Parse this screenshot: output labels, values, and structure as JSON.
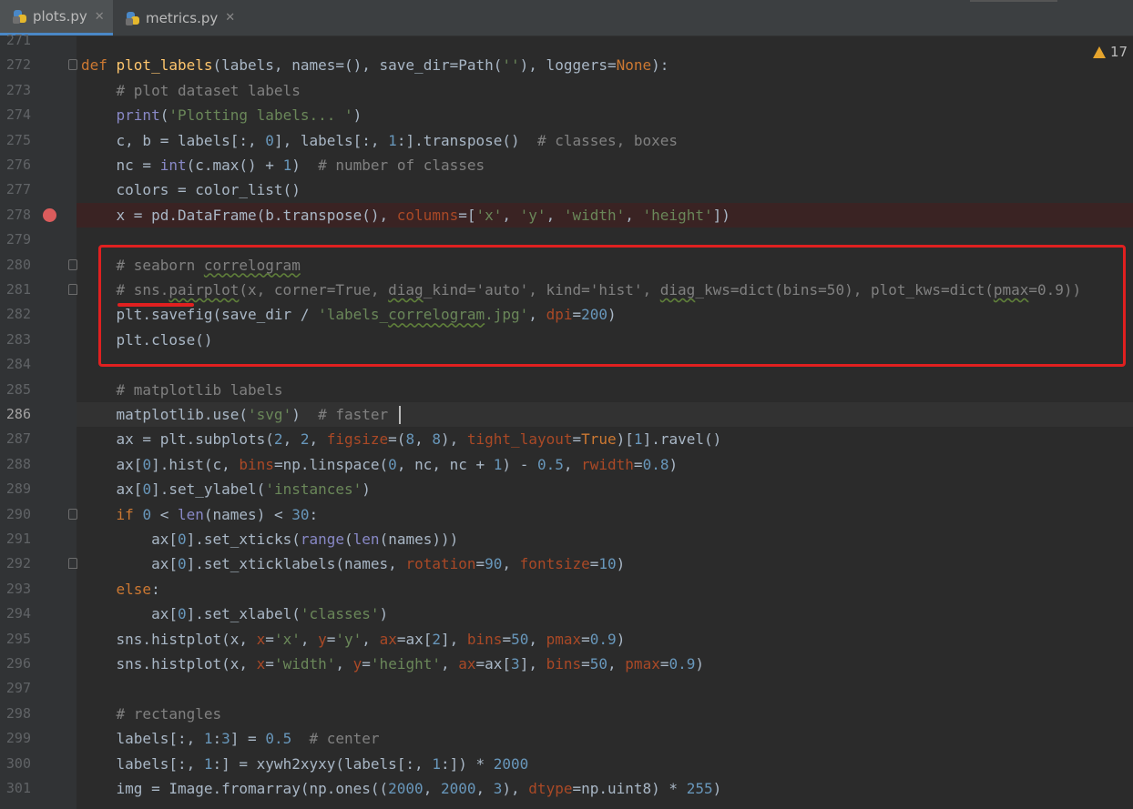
{
  "tabs": [
    {
      "label": "plots.py",
      "active": true
    },
    {
      "label": "metrics.py",
      "active": false
    }
  ],
  "warnings": {
    "count": "17"
  },
  "lines": [
    {
      "n": "271"
    },
    {
      "n": "272"
    },
    {
      "n": "273"
    },
    {
      "n": "274"
    },
    {
      "n": "275"
    },
    {
      "n": "276"
    },
    {
      "n": "277"
    },
    {
      "n": "278"
    },
    {
      "n": "279"
    },
    {
      "n": "280"
    },
    {
      "n": "281"
    },
    {
      "n": "282"
    },
    {
      "n": "283"
    },
    {
      "n": "284"
    },
    {
      "n": "285"
    },
    {
      "n": "286"
    },
    {
      "n": "287"
    },
    {
      "n": "288"
    },
    {
      "n": "289"
    },
    {
      "n": "290"
    },
    {
      "n": "291"
    },
    {
      "n": "292"
    },
    {
      "n": "293"
    },
    {
      "n": "294"
    },
    {
      "n": "295"
    },
    {
      "n": "296"
    },
    {
      "n": "297"
    },
    {
      "n": "298"
    },
    {
      "n": "299"
    },
    {
      "n": "300"
    },
    {
      "n": "301"
    }
  ],
  "code": {
    "l272": [
      [
        "kw",
        "def "
      ],
      [
        "fn",
        "plot_labels"
      ],
      [
        "",
        "(labels, names=(), save_dir=Path("
      ],
      [
        "str",
        "''"
      ],
      [
        "",
        "), loggers="
      ],
      [
        "kw",
        "None"
      ],
      [
        "",
        "):"
      ]
    ],
    "l273": [
      [
        "",
        "    "
      ],
      [
        "cmt",
        "# plot dataset labels"
      ]
    ],
    "l274": [
      [
        "",
        "    "
      ],
      [
        "bi",
        "print"
      ],
      [
        "",
        "("
      ],
      [
        "str",
        "'Plotting labels... '"
      ],
      [
        "",
        ")"
      ]
    ],
    "l275": [
      [
        "",
        "    c, b = labels[:, "
      ],
      [
        "num",
        "0"
      ],
      [
        "",
        "], labels[:, "
      ],
      [
        "num",
        "1"
      ],
      [
        "",
        ":].transpose()  "
      ],
      [
        "cmt",
        "# classes, boxes"
      ]
    ],
    "l276": [
      [
        "",
        "    nc = "
      ],
      [
        "bi",
        "int"
      ],
      [
        "",
        "(c.max() + "
      ],
      [
        "num",
        "1"
      ],
      [
        "",
        ")  "
      ],
      [
        "cmt",
        "# number of classes"
      ]
    ],
    "l277": [
      [
        "",
        "    colors = color_list()"
      ]
    ],
    "l278": [
      [
        "",
        "    x = pd.DataFrame(b.transpose(), "
      ],
      [
        "param",
        "columns"
      ],
      [
        "",
        "=["
      ],
      [
        "str",
        "'x'"
      ],
      [
        "",
        ", "
      ],
      [
        "str",
        "'y'"
      ],
      [
        "",
        ", "
      ],
      [
        "str",
        "'width'"
      ],
      [
        "",
        ", "
      ],
      [
        "str",
        "'height'"
      ],
      [
        "",
        "])"
      ]
    ],
    "l279": [],
    "l280": [
      [
        "",
        "    "
      ],
      [
        "cmt",
        "# seaborn "
      ],
      [
        "cmt squig",
        "correlogram"
      ]
    ],
    "l281": [
      [
        "",
        "    "
      ],
      [
        "cmt",
        "# sns."
      ],
      [
        "cmt squig",
        "pairplot"
      ],
      [
        "cmt",
        "(x, corner=True, "
      ],
      [
        "cmt squig",
        "diag"
      ],
      [
        "cmt",
        "_kind='auto', kind='hist', "
      ],
      [
        "cmt squig",
        "diag"
      ],
      [
        "cmt",
        "_kws=dict(bins=50), plot_kws=dict("
      ],
      [
        "cmt squig",
        "pmax"
      ],
      [
        "cmt",
        "=0.9))"
      ]
    ],
    "l282": [
      [
        "",
        "    plt.savefig(save_dir / "
      ],
      [
        "str",
        "'labels_"
      ],
      [
        "str squig",
        "correlogram"
      ],
      [
        "str",
        ".jpg'"
      ],
      [
        "",
        ", "
      ],
      [
        "param",
        "dpi"
      ],
      [
        "",
        "="
      ],
      [
        "num",
        "200"
      ],
      [
        "",
        ")"
      ]
    ],
    "l283": [
      [
        "",
        "    plt.close()"
      ]
    ],
    "l284": [],
    "l285": [
      [
        "",
        "    "
      ],
      [
        "cmt",
        "# matplotlib labels"
      ]
    ],
    "l286": [
      [
        "",
        "    matplotlib.use("
      ],
      [
        "str",
        "'svg'"
      ],
      [
        "",
        ")  "
      ],
      [
        "cmt",
        "# faster"
      ]
    ],
    "l287": [
      [
        "",
        "    ax = plt.subplots("
      ],
      [
        "num",
        "2"
      ],
      [
        "",
        ", "
      ],
      [
        "num",
        "2"
      ],
      [
        "",
        ", "
      ],
      [
        "param",
        "figsize"
      ],
      [
        "",
        "=("
      ],
      [
        "num",
        "8"
      ],
      [
        "",
        ", "
      ],
      [
        "num",
        "8"
      ],
      [
        "",
        "), "
      ],
      [
        "param",
        "tight_layout"
      ],
      [
        "",
        "="
      ],
      [
        "kw",
        "True"
      ],
      [
        "",
        ")["
      ],
      [
        "num",
        "1"
      ],
      [
        "",
        "].ravel()"
      ]
    ],
    "l288": [
      [
        "",
        "    ax["
      ],
      [
        "num",
        "0"
      ],
      [
        "",
        "].hist(c, "
      ],
      [
        "param",
        "bins"
      ],
      [
        "",
        "=np.linspace("
      ],
      [
        "num",
        "0"
      ],
      [
        "",
        ", nc, nc + "
      ],
      [
        "num",
        "1"
      ],
      [
        "",
        ") - "
      ],
      [
        "num",
        "0.5"
      ],
      [
        "",
        ", "
      ],
      [
        "param",
        "rwidth"
      ],
      [
        "",
        "="
      ],
      [
        "num",
        "0.8"
      ],
      [
        "",
        ")"
      ]
    ],
    "l289": [
      [
        "",
        "    ax["
      ],
      [
        "num",
        "0"
      ],
      [
        "",
        "].set_ylabel("
      ],
      [
        "str",
        "'instances'"
      ],
      [
        "",
        ")"
      ]
    ],
    "l290": [
      [
        "",
        "    "
      ],
      [
        "kw",
        "if "
      ],
      [
        "num",
        "0"
      ],
      [
        "",
        " < "
      ],
      [
        "bi",
        "len"
      ],
      [
        "",
        "(names) < "
      ],
      [
        "num",
        "30"
      ],
      [
        "",
        ":"
      ]
    ],
    "l291": [
      [
        "",
        "        ax["
      ],
      [
        "num",
        "0"
      ],
      [
        "",
        "].set_xticks("
      ],
      [
        "bi",
        "range"
      ],
      [
        "",
        "("
      ],
      [
        "bi",
        "len"
      ],
      [
        "",
        "(names)))"
      ]
    ],
    "l292": [
      [
        "",
        "        ax["
      ],
      [
        "num",
        "0"
      ],
      [
        "",
        "].set_xticklabels(names, "
      ],
      [
        "param",
        "rotation"
      ],
      [
        "",
        "="
      ],
      [
        "num",
        "90"
      ],
      [
        "",
        ", "
      ],
      [
        "param",
        "fontsize"
      ],
      [
        "",
        "="
      ],
      [
        "num",
        "10"
      ],
      [
        "",
        ")"
      ]
    ],
    "l293": [
      [
        "",
        "    "
      ],
      [
        "kw",
        "else"
      ],
      [
        "",
        ":"
      ]
    ],
    "l294": [
      [
        "",
        "        ax["
      ],
      [
        "num",
        "0"
      ],
      [
        "",
        "].set_xlabel("
      ],
      [
        "str",
        "'classes'"
      ],
      [
        "",
        ")"
      ]
    ],
    "l295": [
      [
        "",
        "    sns.histplot(x, "
      ],
      [
        "param",
        "x"
      ],
      [
        "",
        "="
      ],
      [
        "str",
        "'x'"
      ],
      [
        "",
        ", "
      ],
      [
        "param",
        "y"
      ],
      [
        "",
        "="
      ],
      [
        "str",
        "'y'"
      ],
      [
        "",
        ", "
      ],
      [
        "param",
        "ax"
      ],
      [
        "",
        "=ax["
      ],
      [
        "num",
        "2"
      ],
      [
        "",
        "], "
      ],
      [
        "param",
        "bins"
      ],
      [
        "",
        "="
      ],
      [
        "num",
        "50"
      ],
      [
        "",
        ", "
      ],
      [
        "param",
        "pmax"
      ],
      [
        "",
        "="
      ],
      [
        "num",
        "0.9"
      ],
      [
        "",
        ")"
      ]
    ],
    "l296": [
      [
        "",
        "    sns.histplot(x, "
      ],
      [
        "param",
        "x"
      ],
      [
        "",
        "="
      ],
      [
        "str",
        "'width'"
      ],
      [
        "",
        ", "
      ],
      [
        "param",
        "y"
      ],
      [
        "",
        "="
      ],
      [
        "str",
        "'height'"
      ],
      [
        "",
        ", "
      ],
      [
        "param",
        "ax"
      ],
      [
        "",
        "=ax["
      ],
      [
        "num",
        "3"
      ],
      [
        "",
        "], "
      ],
      [
        "param",
        "bins"
      ],
      [
        "",
        "="
      ],
      [
        "num",
        "50"
      ],
      [
        "",
        ", "
      ],
      [
        "param",
        "pmax"
      ],
      [
        "",
        "="
      ],
      [
        "num",
        "0.9"
      ],
      [
        "",
        ")"
      ]
    ],
    "l297": [],
    "l298": [
      [
        "",
        "    "
      ],
      [
        "cmt",
        "# rectangles"
      ]
    ],
    "l299": [
      [
        "",
        "    labels[:, "
      ],
      [
        "num",
        "1"
      ],
      [
        "",
        ":"
      ],
      [
        "num",
        "3"
      ],
      [
        "",
        "] = "
      ],
      [
        "num",
        "0.5"
      ],
      [
        "",
        "  "
      ],
      [
        "cmt",
        "# center"
      ]
    ],
    "l300": [
      [
        "",
        "    labels[:, "
      ],
      [
        "num",
        "1"
      ],
      [
        "",
        ":] = xywh2xyxy(labels[:, "
      ],
      [
        "num",
        "1"
      ],
      [
        "",
        ":]) * "
      ],
      [
        "num",
        "2000"
      ]
    ],
    "l301": [
      [
        "",
        "    img = Image.fromarray(np.ones(("
      ],
      [
        "num",
        "2000"
      ],
      [
        "",
        ", "
      ],
      [
        "num",
        "2000"
      ],
      [
        "",
        ", "
      ],
      [
        "num",
        "3"
      ],
      [
        "",
        "), "
      ],
      [
        "param",
        "dtype"
      ],
      [
        "",
        "=np.uint8) * "
      ],
      [
        "num",
        "255"
      ],
      [
        "",
        ")"
      ]
    ]
  }
}
